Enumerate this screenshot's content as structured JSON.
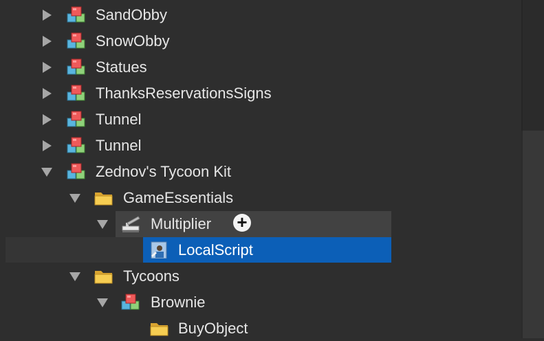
{
  "tree": {
    "items": [
      {
        "label": "SandObby",
        "icon": "model-icon",
        "expander": "collapsed"
      },
      {
        "label": "SnowObby",
        "icon": "model-icon",
        "expander": "collapsed"
      },
      {
        "label": "Statues",
        "icon": "model-icon",
        "expander": "collapsed"
      },
      {
        "label": "ThanksReservationsSigns",
        "icon": "model-icon",
        "expander": "collapsed"
      },
      {
        "label": "Tunnel",
        "icon": "model-icon",
        "expander": "collapsed"
      },
      {
        "label": "Tunnel",
        "icon": "model-icon",
        "expander": "collapsed"
      },
      {
        "label": "Zednov's Tycoon Kit",
        "icon": "model-icon",
        "expander": "expanded"
      },
      {
        "label": "GameEssentials",
        "icon": "folder-icon",
        "expander": "expanded"
      },
      {
        "label": "Multiplier",
        "icon": "tool-icon",
        "expander": "expanded",
        "state": "hovered"
      },
      {
        "label": "LocalScript",
        "icon": "local-script-icon",
        "expander": "none",
        "state": "selected"
      },
      {
        "label": "Tycoons",
        "icon": "folder-icon",
        "expander": "expanded"
      },
      {
        "label": "Brownie",
        "icon": "model-icon",
        "expander": "expanded"
      },
      {
        "label": "BuyObject",
        "icon": "folder-icon",
        "expander": "none"
      }
    ],
    "insert_button_glyph": "+"
  },
  "colors": {
    "background": "#2e2e2e",
    "selection": "#0c5fb7",
    "hover": "#424242",
    "text": "#e6e6e6",
    "folder": "#f2c040"
  }
}
